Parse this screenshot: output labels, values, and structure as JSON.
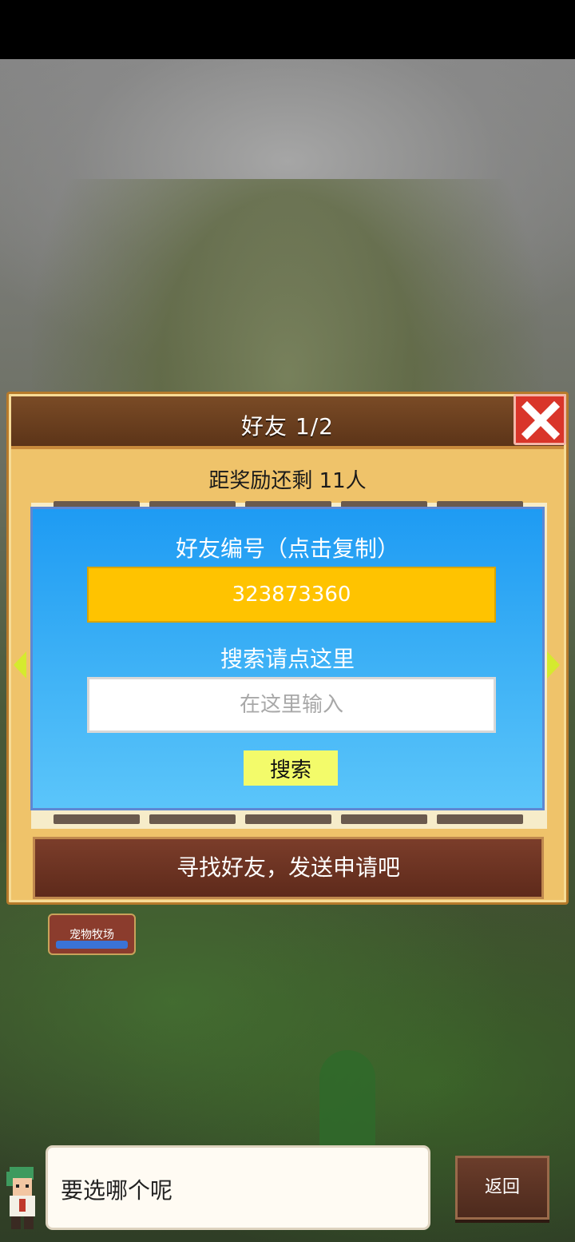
{
  "dialog": {
    "title": "好友    1/2",
    "remaining": "距奖励还剩 11人",
    "friend_id_label": "好友编号（点击复制）",
    "friend_id": "323873360",
    "search_label": "搜索请点这里",
    "search_placeholder": "在这里输入",
    "search_button": "搜索",
    "find_button": "寻找好友，发送申请吧"
  },
  "background": {
    "ranch_label": "宠物牧场"
  },
  "bottom": {
    "speech": "要选哪个呢",
    "back_button": "返回"
  },
  "colors": {
    "id_box": "#ffc300",
    "panel": "#39aef5",
    "close": "#d9352a"
  },
  "icons": {
    "close": "close-icon",
    "left_arrow": "left-arrow-icon",
    "right_arrow": "right-arrow-icon",
    "character": "character-avatar"
  }
}
